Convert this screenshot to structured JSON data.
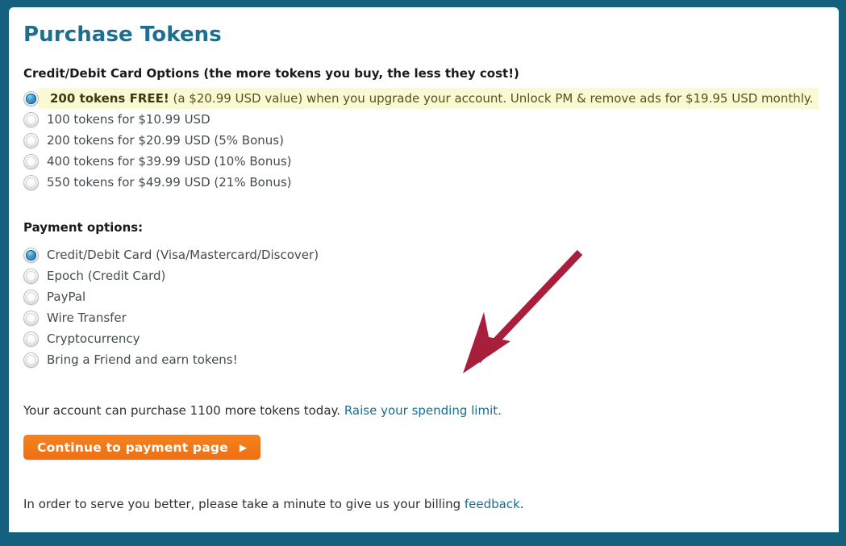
{
  "theme": {
    "frame_color": "#15607F",
    "card_background": "#FFFFFF",
    "title_color": "#1E6E8E",
    "link_color": "#1B6D91",
    "highlight_background": "#FBF8D4",
    "button_color": "#ED7014",
    "annotation_arrow_color": "#A81F3C"
  },
  "page": {
    "title": "Purchase Tokens"
  },
  "token_options": {
    "heading": "Credit/Debit Card Options (the more tokens you buy, the less they cost!)",
    "items": [
      {
        "checked": true,
        "highlighted": true,
        "bold_prefix": "200 tokens FREE!",
        "label": " (a $20.99 USD value) when you upgrade your account. Unlock PM & remove ads for $19.95 USD monthly."
      },
      {
        "checked": false,
        "highlighted": false,
        "bold_prefix": "",
        "label": "100 tokens for $10.99 USD"
      },
      {
        "checked": false,
        "highlighted": false,
        "bold_prefix": "",
        "label": "200 tokens for $20.99 USD (5% Bonus)"
      },
      {
        "checked": false,
        "highlighted": false,
        "bold_prefix": "",
        "label": "400 tokens for $39.99 USD (10% Bonus)"
      },
      {
        "checked": false,
        "highlighted": false,
        "bold_prefix": "",
        "label": "550 tokens for $49.99 USD (21% Bonus)"
      }
    ]
  },
  "payment_options": {
    "heading": "Payment options:",
    "items": [
      {
        "checked": true,
        "label": "Credit/Debit Card (Visa/Mastercard/Discover)"
      },
      {
        "checked": false,
        "label": "Epoch (Credit Card)"
      },
      {
        "checked": false,
        "label": "PayPal"
      },
      {
        "checked": false,
        "label": "Wire Transfer"
      },
      {
        "checked": false,
        "label": "Cryptocurrency"
      },
      {
        "checked": false,
        "label": "Bring a Friend and earn tokens!"
      }
    ]
  },
  "spending_limit": {
    "text": "Your account can purchase 1100 more tokens today.",
    "link_label": "Raise your spending limit."
  },
  "continue_button": {
    "label": "Continue to payment page",
    "arrow_glyph": "▶"
  },
  "feedback": {
    "text_before": "In order to serve you better, please take a minute to give us your billing ",
    "link_label": "feedback",
    "text_after": "."
  },
  "annotation": {
    "icon": "red-arrow-icon",
    "points_to": "payment options area"
  }
}
